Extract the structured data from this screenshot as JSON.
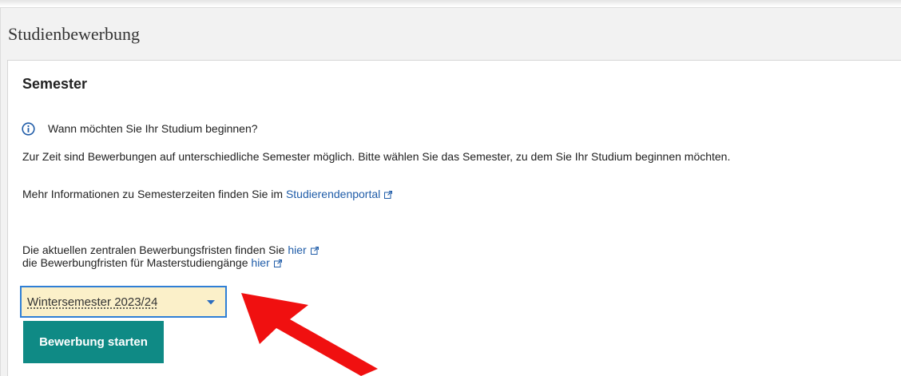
{
  "page": {
    "title": "Studienbewerbung"
  },
  "semester_section": {
    "title": "Semester",
    "icon": "info-circle-icon",
    "question": "Wann möchten Sie Ihr Studium beginnen?",
    "intro": "Zur Zeit sind Bewerbungen auf unterschiedliche Semester möglich. Bitte wählen Sie das Semester, zu dem Sie Ihr Studium beginnen möchten.",
    "portal_text": "Mehr Informationen zu Semesterzeiten finden Sie im ",
    "portal_link": "Studierendenportal",
    "deadlines_text": "Die aktuellen zentralen Bewerbungsfristen finden Sie ",
    "deadlines_link": "hier",
    "master_text": "die Bewerbungfristen für Masterstudiengänge ",
    "master_link": "hier"
  },
  "semester_select": {
    "selected": "Wintersemester 2023/24",
    "caret_icon": "chevron-down-icon"
  },
  "start_button": {
    "label": "Bewerbung starten"
  },
  "annotation": {
    "icon": "red-arrow-icon"
  },
  "colors": {
    "link": "#1f5ca8",
    "button": "#0f8a85",
    "select_background": "#fbf0c9",
    "select_border": "#2f7fd6",
    "arrow": "#f01010",
    "panel_background": "#f2f2f2"
  }
}
